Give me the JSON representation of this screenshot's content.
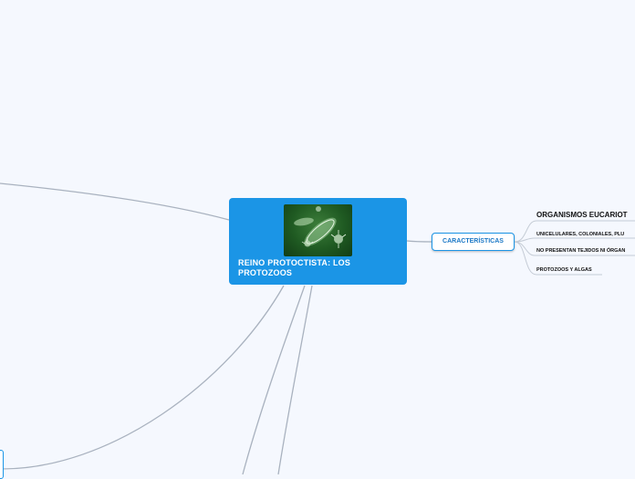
{
  "colors": {
    "background": "#f5f8fe",
    "central_fill": "#1b95e6",
    "central_text": "#ffffff",
    "subtopic_border": "#1b95e6",
    "subtopic_text": "#1b78c6",
    "connector": "#a9b2bf",
    "leaf_text": "#111111"
  },
  "central_topic": {
    "title": "REINO PROTOCTISTA: LOS PROTOZOOS",
    "image_icon": "microorganism-photo"
  },
  "subtopic": {
    "label": "CARACTERÍSTICAS"
  },
  "leaves": [
    "ORGANISMOS EUCARIOT",
    "UNICELULARES, COLONIALES, PLU",
    "NO PRESENTAN TEJIDOS NI ÓRGAN",
    "PROTOZOOS Y ALGAS"
  ]
}
